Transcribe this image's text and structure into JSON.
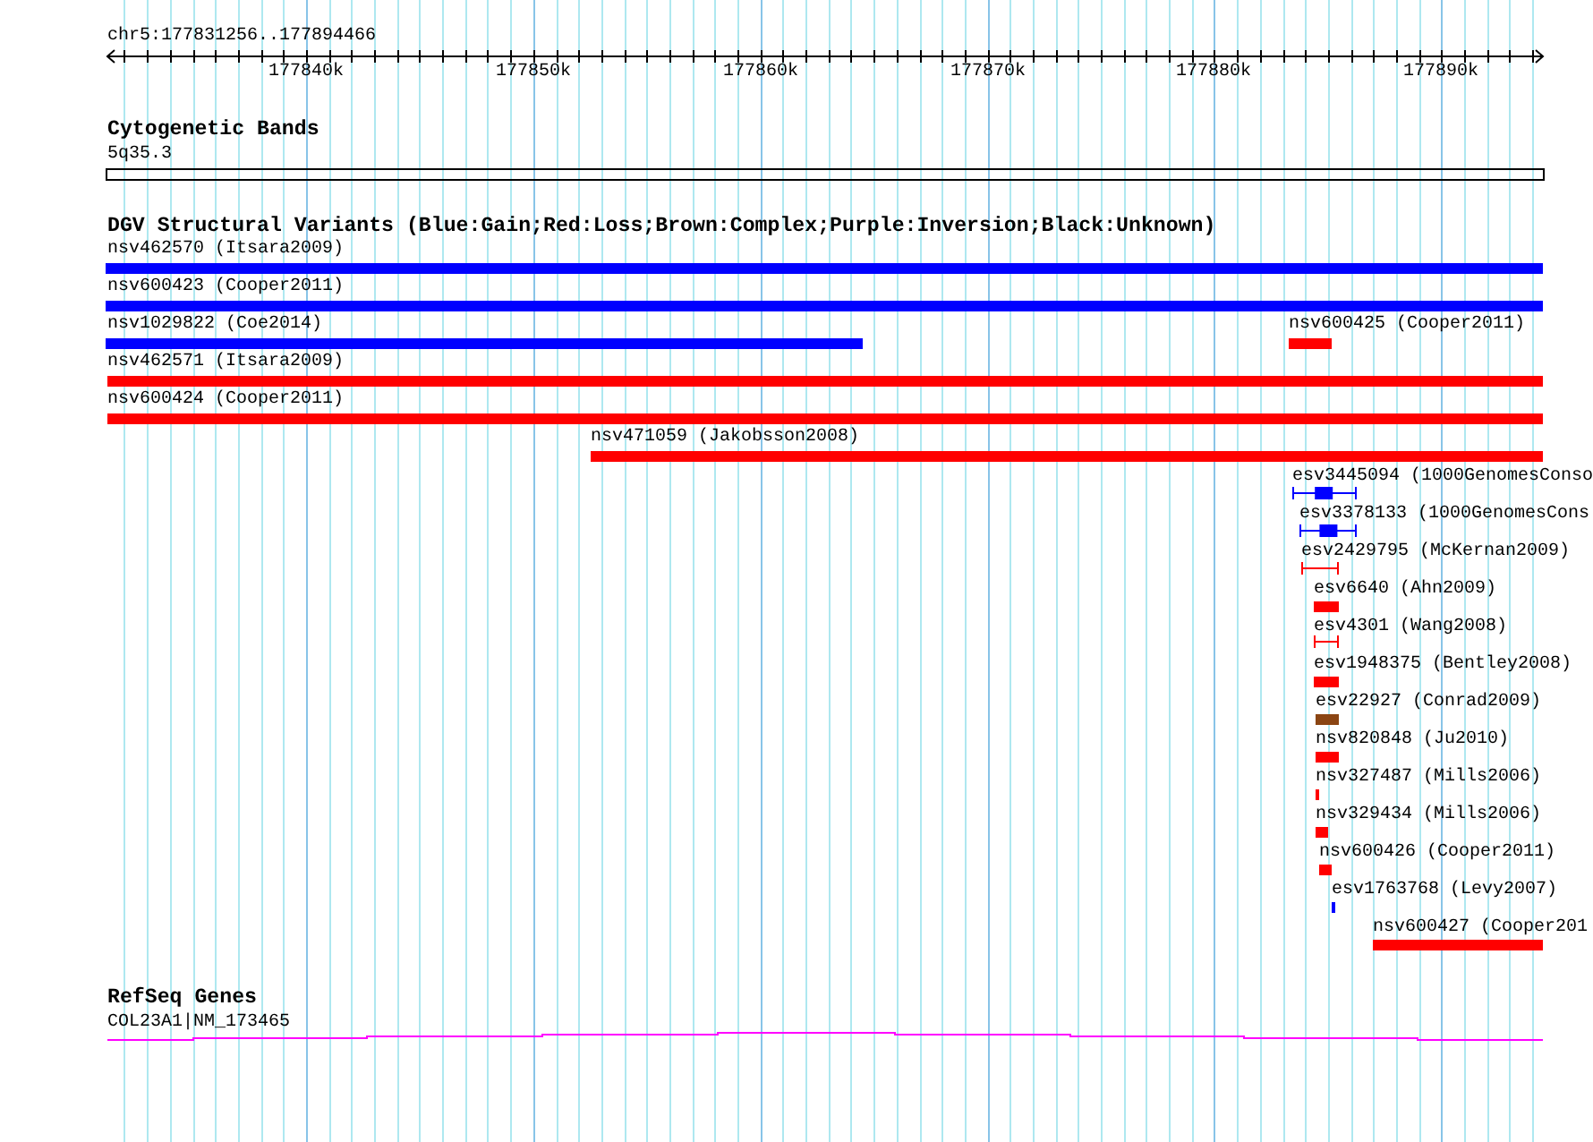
{
  "ruler": {
    "title": "chr5:177831256..177894466",
    "ticks": [
      "177840k",
      "177850k",
      "177860k",
      "177870k",
      "177880k",
      "177890k"
    ]
  },
  "cytogenetic_bands": {
    "title": "Cytogenetic Bands",
    "band": "5q35.3"
  },
  "dgv": {
    "title": "DGV Structural Variants (Blue:Gain;Red:Loss;Brown:Complex;Purple:Inversion;Black:Unknown)",
    "features": [
      {
        "label": "nsv462570 (Itsara2009)",
        "color": "#0000ff",
        "kind": "box"
      },
      {
        "label": "nsv600423 (Cooper2011)",
        "color": "#0000ff",
        "kind": "box"
      },
      {
        "label": "nsv1029822 (Coe2014)",
        "color": "#0000ff",
        "kind": "box"
      },
      {
        "label": "nsv600425 (Cooper2011)",
        "color": "#ff0000",
        "kind": "box"
      },
      {
        "label": "nsv462571 (Itsara2009)",
        "color": "#ff0000",
        "kind": "box"
      },
      {
        "label": "nsv600424 (Cooper2011)",
        "color": "#ff0000",
        "kind": "box"
      },
      {
        "label": "nsv471059 (Jakobsson2008)",
        "color": "#ff0000",
        "kind": "box"
      },
      {
        "label": "esv3445094 (1000GenomesConso",
        "color": "#0000ff",
        "kind": "line_box"
      },
      {
        "label": "esv3378133 (1000GenomesCons",
        "color": "#0000ff",
        "kind": "line_box"
      },
      {
        "label": "esv2429795 (McKernan2009)",
        "color": "#ff0000",
        "kind": "line"
      },
      {
        "label": "esv6640 (Ahn2009)",
        "color": "#ff0000",
        "kind": "box"
      },
      {
        "label": "esv4301 (Wang2008)",
        "color": "#ff0000",
        "kind": "line"
      },
      {
        "label": "esv1948375 (Bentley2008)",
        "color": "#ff0000",
        "kind": "box"
      },
      {
        "label": "esv22927 (Conrad2009)",
        "color": "#8b4513",
        "kind": "box"
      },
      {
        "label": "nsv820848 (Ju2010)",
        "color": "#ff0000",
        "kind": "box"
      },
      {
        "label": "nsv327487 (Mills2006)",
        "color": "#ff0000",
        "kind": "box"
      },
      {
        "label": "nsv329434 (Mills2006)",
        "color": "#ff0000",
        "kind": "box"
      },
      {
        "label": "nsv600426 (Cooper2011)",
        "color": "#ff0000",
        "kind": "box"
      },
      {
        "label": "esv1763768 (Levy2007)",
        "color": "#0000ff",
        "kind": "box"
      },
      {
        "label": "nsv600427 (Cooper201",
        "color": "#ff0000",
        "kind": "box"
      }
    ]
  },
  "refseq_genes": {
    "title": "RefSeq Genes",
    "gene": "COL23A1|NM_173465"
  }
}
